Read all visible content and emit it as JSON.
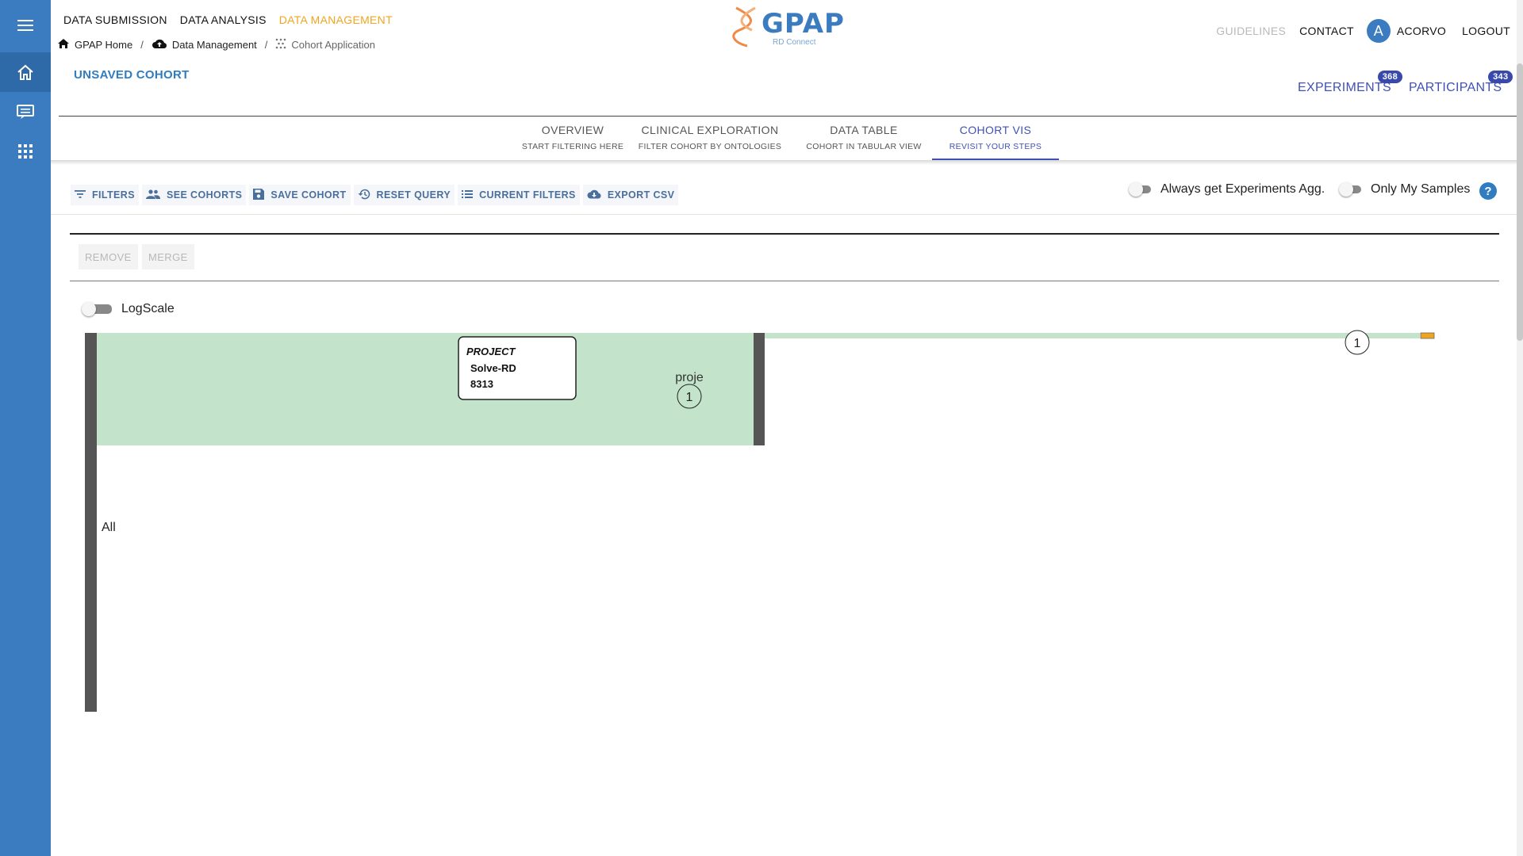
{
  "top_nav": {
    "items": [
      {
        "label": "DATA SUBMISSION",
        "active": false
      },
      {
        "label": "DATA ANALYSIS",
        "active": false
      },
      {
        "label": "DATA MANAGEMENT",
        "active": true
      }
    ]
  },
  "breadcrumb": {
    "home": "GPAP Home",
    "data_management": "Data Management",
    "current": "Cohort Application"
  },
  "logo": {
    "name": "GPAP",
    "subtitle": "RD Connect"
  },
  "right_nav": {
    "guidelines": "GUIDELINES",
    "contact": "CONTACT",
    "avatar_letter": "A",
    "user": "ACORVO",
    "logout": "LOGOUT"
  },
  "cohort": {
    "title": "UNSAVED COHORT"
  },
  "counters": {
    "experiments": {
      "label": "EXPERIMENTS",
      "count": "368"
    },
    "participants": {
      "label": "PARTICIPANTS",
      "count": "343"
    }
  },
  "tabs": [
    {
      "label": "OVERVIEW",
      "sub": "START FILTERING HERE",
      "active": false
    },
    {
      "label": "CLINICAL EXPLORATION",
      "sub": "FILTER COHORT BY ONTOLOGIES",
      "active": false
    },
    {
      "label": "DATA TABLE",
      "sub": "COHORT IN TABULAR VIEW",
      "active": false
    },
    {
      "label": "COHORT VIS",
      "sub": "REVISIT YOUR STEPS",
      "active": true
    }
  ],
  "toolbar": {
    "filters": "FILTERS",
    "see_cohorts": "SEE COHORTS",
    "save_cohort": "SAVE COHORT",
    "reset_query": "RESET QUERY",
    "current_filters": "CURRENT FILTERS",
    "export_csv": "EXPORT CSV"
  },
  "toggles": {
    "experiments_agg": {
      "label": "Always get Experiments Agg.",
      "on": false
    },
    "only_my_samples": {
      "label": "Only My Samples",
      "on": false
    },
    "log_scale": {
      "label": "LogScale",
      "on": false
    }
  },
  "help_label": "?",
  "actions": {
    "remove": "REMOVE",
    "merge": "MERGE"
  },
  "cohort_vis": {
    "root_label": "All",
    "filter_node": {
      "label": "proje",
      "count": "1"
    },
    "tooltip": {
      "heading": "PROJECT",
      "name": "Solve-RD",
      "value": "8313"
    },
    "end_node": {
      "count": "1"
    },
    "colors": {
      "block": "#c3e4cb",
      "bar": "#555555",
      "marker": "#f0a51f"
    }
  }
}
